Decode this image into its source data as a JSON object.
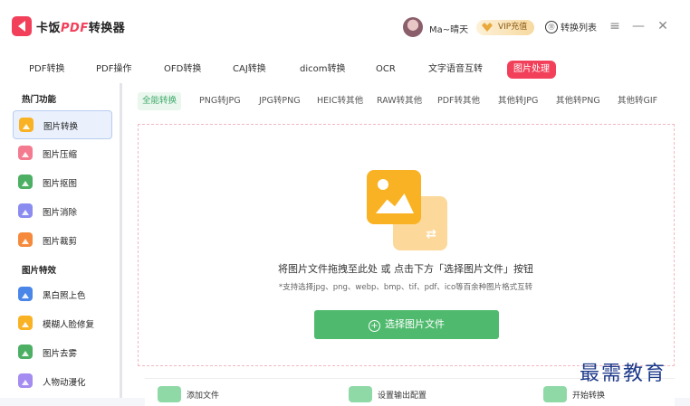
{
  "app": {
    "title_prefix": "卡饭",
    "title_pdf": "PDF",
    "title_suffix": "转换器"
  },
  "user": {
    "name": "Ma~晴天",
    "vip_label": "VIP充值"
  },
  "header": {
    "convert_list_label": "转换列表",
    "convert_list_icon": "⑪"
  },
  "window": {
    "menu": "≡",
    "minimize": "—",
    "close": "✕"
  },
  "top_tabs": [
    "PDF转换",
    "PDF操作",
    "OFD转换",
    "CAJ转换",
    "dicom转换",
    "OCR",
    "文字语音互转",
    "图片处理"
  ],
  "sidebar": {
    "group1_title": "热门功能",
    "group1_items": [
      {
        "label": "图片转换",
        "color": "#f9b224"
      },
      {
        "label": "图片压缩",
        "color": "#f47b8f"
      },
      {
        "label": "图片抠图",
        "color": "#4caf63"
      },
      {
        "label": "图片消除",
        "color": "#8a8cf0"
      },
      {
        "label": "图片裁剪",
        "color": "#f58a3c"
      }
    ],
    "group2_title": "图片特效",
    "group2_items": [
      {
        "label": "黑白照上色",
        "color": "#4a86e8"
      },
      {
        "label": "模糊人脸修复",
        "color": "#f9b224"
      },
      {
        "label": "图片去雾",
        "color": "#4caf63"
      },
      {
        "label": "人物动漫化",
        "color": "#a48cf0"
      }
    ]
  },
  "sub_tabs": [
    "全能转换",
    "PNG转JPG",
    "JPG转PNG",
    "HEIC转其他",
    "RAW转其他",
    "PDF转其他",
    "其他转JPG",
    "其他转PNG",
    "其他转GIF"
  ],
  "dropzone": {
    "title": "将图片文件拖拽至此处 或 点击下方「选择图片文件」按钮",
    "subtitle": "*支持选择jpg、png、webp、bmp、tif、pdf、ico等百余种图片格式互转",
    "button_label": "选择图片文件",
    "button_icon": "+"
  },
  "bottom_steps": [
    "添加文件",
    "设置输出配置",
    "开始转换"
  ],
  "watermark": "最需教育",
  "colors": {
    "accent": "#f2405a",
    "green": "#4fba6e",
    "active_tab_bg": "#eaf7ee"
  }
}
